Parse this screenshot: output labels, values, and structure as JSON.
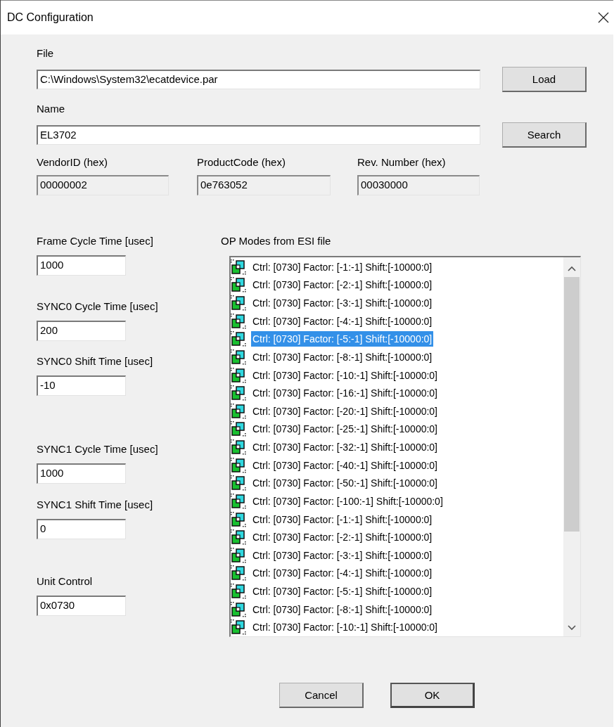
{
  "window": {
    "title": "DC Configuration"
  },
  "file": {
    "label": "File",
    "value": "C:\\Windows\\System32\\ecatdevice.par",
    "button": "Load"
  },
  "name": {
    "label": "Name",
    "value": "EL3702",
    "button": "Search"
  },
  "ids": [
    {
      "label": "VendorID (hex)",
      "value": "00000002",
      "readonly": true
    },
    {
      "label": "ProductCode (hex)",
      "value": "0e763052",
      "readonly": true
    },
    {
      "label": "Rev. Number (hex)",
      "value": "00030000",
      "readonly": true
    }
  ],
  "timing": [
    {
      "label": "Frame Cycle Time [usec]",
      "value": "1000"
    },
    {
      "label": "SYNC0 Cycle Time [usec]",
      "value": "200"
    },
    {
      "label": "SYNC0 Shift Time [usec]",
      "value": "-10"
    },
    {
      "label": "SYNC1 Cycle Time [usec]",
      "value": "1000"
    },
    {
      "label": "SYNC1 Shift Time [usec]",
      "value": "0"
    },
    {
      "label": "Unit Control",
      "value": "0x0730"
    }
  ],
  "op_modes": {
    "label": "OP Modes from ESI file",
    "items": [
      {
        "text": "Ctrl: [0730] Factor: [-1:-1] Shift:[-10000:0]",
        "selected": false
      },
      {
        "text": "Ctrl: [0730] Factor: [-2:-1] Shift:[-10000:0]",
        "selected": false
      },
      {
        "text": "Ctrl: [0730] Factor: [-3:-1] Shift:[-10000:0]",
        "selected": false
      },
      {
        "text": "Ctrl: [0730] Factor: [-4:-1] Shift:[-10000:0]",
        "selected": false
      },
      {
        "text": "Ctrl: [0730] Factor: [-5:-1] Shift:[-10000:0]",
        "selected": true
      },
      {
        "text": "Ctrl: [0730] Factor: [-8:-1] Shift:[-10000:0]",
        "selected": false
      },
      {
        "text": "Ctrl: [0730] Factor: [-10:-1] Shift:[-10000:0]",
        "selected": false
      },
      {
        "text": "Ctrl: [0730] Factor: [-16:-1] Shift:[-10000:0]",
        "selected": false
      },
      {
        "text": "Ctrl: [0730] Factor: [-20:-1] Shift:[-10000:0]",
        "selected": false
      },
      {
        "text": "Ctrl: [0730] Factor: [-25:-1] Shift:[-10000:0]",
        "selected": false
      },
      {
        "text": "Ctrl: [0730] Factor: [-32:-1] Shift:[-10000:0]",
        "selected": false
      },
      {
        "text": "Ctrl: [0730] Factor: [-40:-1] Shift:[-10000:0]",
        "selected": false
      },
      {
        "text": "Ctrl: [0730] Factor: [-50:-1] Shift:[-10000:0]",
        "selected": false
      },
      {
        "text": "Ctrl: [0730] Factor: [-100:-1] Shift:[-10000:0]",
        "selected": false
      },
      {
        "text": "Ctrl: [0730] Factor: [-1:-1] Shift:[-10000:0]",
        "selected": false
      },
      {
        "text": "Ctrl: [0730] Factor: [-2:-1] Shift:[-10000:0]",
        "selected": false
      },
      {
        "text": "Ctrl: [0730] Factor: [-3:-1] Shift:[-10000:0]",
        "selected": false
      },
      {
        "text": "Ctrl: [0730] Factor: [-4:-1] Shift:[-10000:0]",
        "selected": false
      },
      {
        "text": "Ctrl: [0730] Factor: [-5:-1] Shift:[-10000:0]",
        "selected": false
      },
      {
        "text": "Ctrl: [0730] Factor: [-8:-1] Shift:[-10000:0]",
        "selected": false
      },
      {
        "text": "Ctrl: [0730] Factor: [-10:-1] Shift:[-10000:0]",
        "selected": false
      }
    ]
  },
  "buttons": [
    {
      "label": "Cancel",
      "default": false
    },
    {
      "label": "OK",
      "default": true
    }
  ]
}
